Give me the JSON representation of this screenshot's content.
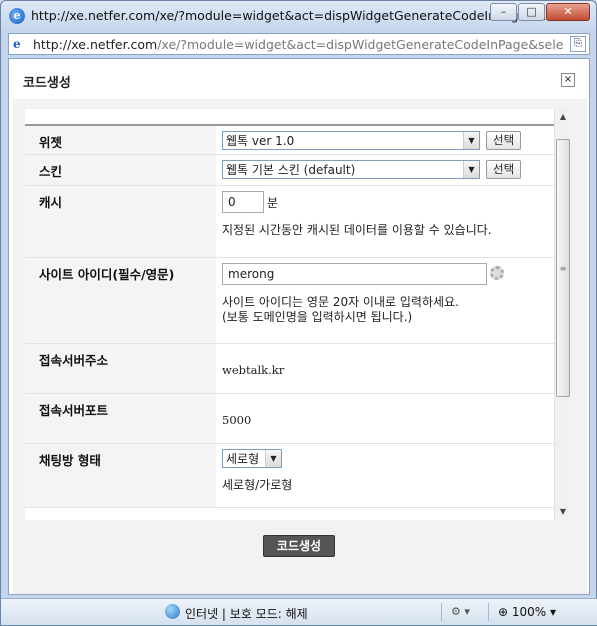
{
  "window": {
    "title": "http://xe.netfer.com/xe/?module=widget&act=dispWidgetGenerateCodeInPage&s...",
    "minimize": "–",
    "maximize": "□",
    "close": "✕"
  },
  "address_bar": {
    "url_host": "http://xe.netfer.com",
    "url_rest": "/xe/?module=widget&act=dispWidgetGenerateCodeInPage&selected_widget="
  },
  "popup": {
    "title": "코드생성",
    "close": "×"
  },
  "form": {
    "widget": {
      "label": "위젯",
      "value": "웹톡 ver 1.0",
      "button": "선택"
    },
    "skin": {
      "label": "스킨",
      "value": "웹톡 기본 스킨 (default)",
      "button": "선택"
    },
    "cache": {
      "label": "캐시",
      "value": "0",
      "unit": "분",
      "desc": "지정된 시간동안 캐시된 데이터를 이용할 수 있습니다."
    },
    "site_id": {
      "label": "사이트 아이디(필수/영문)",
      "value": "merong",
      "desc_1": "사이트 아이디는 영문 20자 이내로 입력하세요.",
      "desc_2": "(보통 도메인명을 입력하시면 됩니다.)"
    },
    "server_addr": {
      "label": "접속서버주소",
      "value": "webtalk.kr"
    },
    "server_port": {
      "label": "접속서버포트",
      "value": "5000"
    },
    "chat_type": {
      "label": "채팅방 형태",
      "value": "세로형",
      "desc": "세로형/가로형"
    }
  },
  "generate_button": "코드생성",
  "status_bar": {
    "zone": "인터넷 | 보호 모드: 해제",
    "zoom": "100%"
  }
}
